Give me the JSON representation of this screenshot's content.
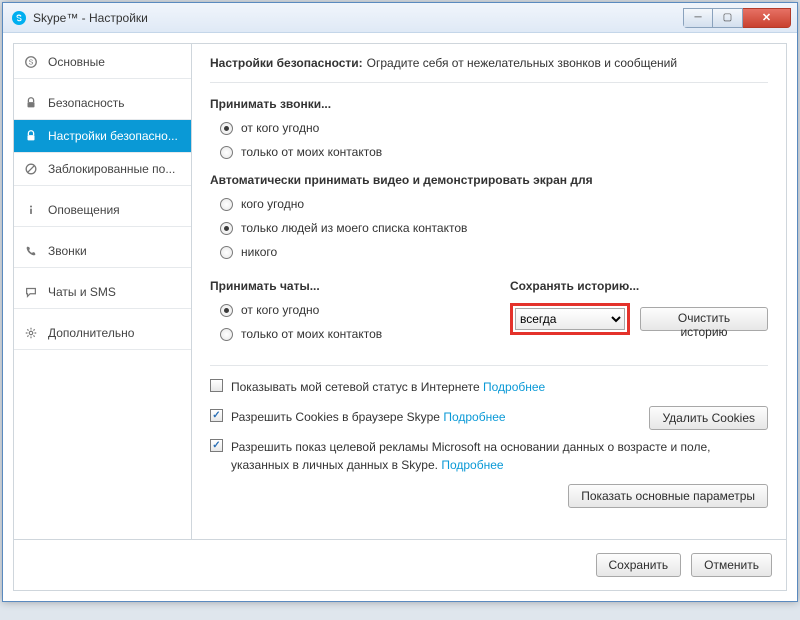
{
  "window": {
    "title": "Skype™ - Настройки"
  },
  "sidebar": {
    "items": [
      {
        "label": "Основные",
        "icon": "skype"
      },
      {
        "label": "Безопасность",
        "icon": "lock"
      },
      {
        "label": "Настройки безопасно...",
        "icon": "lock",
        "active": true
      },
      {
        "label": "Заблокированные по...",
        "icon": "blocked"
      },
      {
        "label": "Оповещения",
        "icon": "info"
      },
      {
        "label": "Звонки",
        "icon": "phone"
      },
      {
        "label": "Чаты и SMS",
        "icon": "chat"
      },
      {
        "label": "Дополнительно",
        "icon": "gear"
      }
    ]
  },
  "main": {
    "heading_bold": "Настройки безопасности:",
    "heading_rest": "Оградите себя от нежелательных звонков и сообщений",
    "sec1": {
      "title": "Принимать звонки...",
      "opt1": "от кого угодно",
      "opt2": "только от моих контактов"
    },
    "sec2": {
      "title": "Автоматически принимать видео и демонстрировать экран для",
      "opt1": "кого угодно",
      "opt2": "только людей из моего списка контактов",
      "opt3": "никого"
    },
    "sec3": {
      "title": "Принимать чаты...",
      "opt1": "от кого угодно",
      "opt2": "только от моих контактов"
    },
    "history": {
      "title": "Сохранять историю...",
      "selected": "всегда",
      "clear_btn": "Очистить историю"
    },
    "checks": {
      "c1": "Показывать мой сетевой статус в Интернете",
      "c2": "Разрешить Cookies в браузере Skype",
      "c3": "Разрешить показ целевой рекламы Microsoft на основании данных о возрасте и поле, указанных в личных данных в Skype.",
      "more": "Подробнее",
      "delete_cookies": "Удалить Cookies"
    },
    "toggle_btn": "Показать основные параметры"
  },
  "footer": {
    "save": "Сохранить",
    "cancel": "Отменить"
  }
}
